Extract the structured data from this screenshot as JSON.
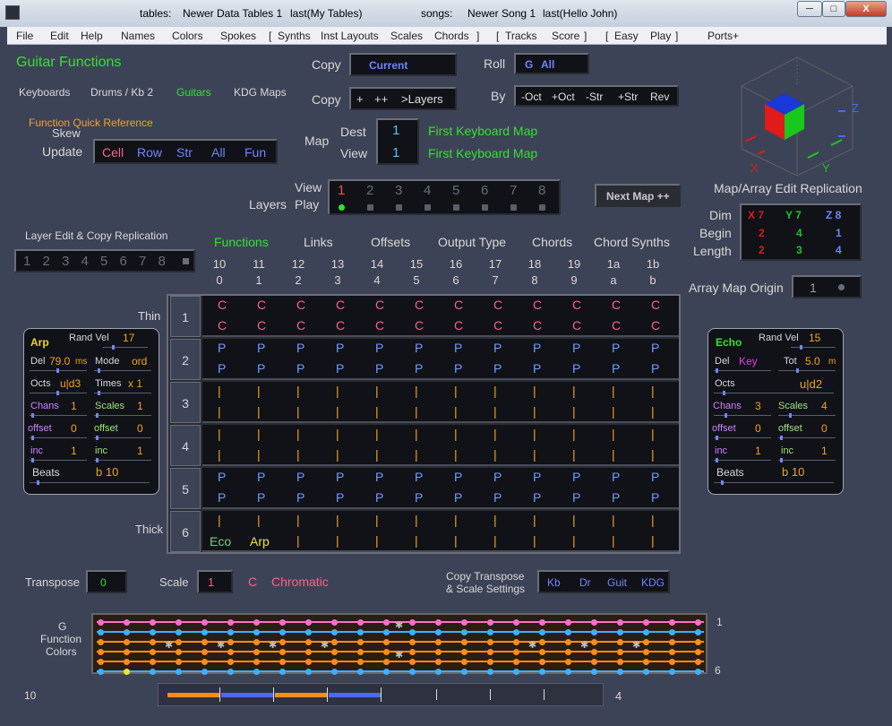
{
  "titlebar": {
    "tables_label": "tables:",
    "tables_value": "Newer Data Tables 1",
    "tables_last": "last(My Tables)",
    "songs_label": "songs:",
    "songs_value": "Newer Song 1",
    "songs_last": "last(Hello John)",
    "min": "─",
    "max": "□",
    "close": "X"
  },
  "menu": [
    "File",
    "Edit",
    "Help",
    "Names",
    "Colors",
    "Spokes",
    "[",
    "Synths",
    "Inst Layouts",
    "Scales",
    "Chords",
    "]",
    "[",
    "Tracks",
    "Score",
    "]",
    "[",
    "Easy",
    "Play",
    "]",
    "Ports+"
  ],
  "header": {
    "title": "Guitar  Functions",
    "tabs": [
      "Keyboards",
      "Drums / Kb 2",
      "Guitars",
      "KDG Maps"
    ],
    "quick_ref": "Function Quick Reference",
    "skew": "Skew",
    "update_label": "Update",
    "update_opts": [
      "Cell",
      "Row",
      "Str",
      "All",
      "Fun"
    ]
  },
  "copy": {
    "label1": "Copy",
    "value1": "Current",
    "label2": "Copy",
    "opts2": [
      "+",
      "++",
      ">Layers"
    ]
  },
  "roll": {
    "label": "Roll",
    "key": "G",
    "value": "All"
  },
  "by": {
    "label": "By",
    "opts": [
      "-Oct",
      "+Oct",
      "-Str",
      "+Str",
      "Rev"
    ]
  },
  "map": {
    "label": "Map",
    "dest_label": "Dest",
    "dest_value": "1",
    "dest_name": "First Keyboard Map",
    "view_label": "View",
    "view_value": "1",
    "view_name": "First Keyboard Map"
  },
  "layers": {
    "view_label": "View",
    "play_label": "Play",
    "layers_label": "Layers",
    "nums": [
      "1",
      "2",
      "3",
      "4",
      "5",
      "6",
      "7",
      "8"
    ]
  },
  "next_map": "Next Map ++",
  "cube": {
    "z": "Z",
    "x": "X",
    "y": "Y"
  },
  "replication": {
    "title": "Map/Array Edit Replication",
    "rows": [
      "Dim",
      "Begin",
      "Length"
    ],
    "dim": [
      "X 7",
      "Y 7",
      "Z 8"
    ],
    "begin": [
      "2",
      "4",
      "1"
    ],
    "length": [
      "2",
      "3",
      "4"
    ],
    "origin_label": "Array Map Origin",
    "origin_value": "1"
  },
  "layer_edit": {
    "title": "Layer Edit & Copy Replication",
    "nums": [
      "1",
      "2",
      "3",
      "4",
      "5",
      "6",
      "7",
      "8"
    ]
  },
  "columns": {
    "tabs": [
      "Functions",
      "Links",
      "Offsets",
      "Output Type",
      "Chords",
      "Chord Synths"
    ],
    "top": [
      "10",
      "11",
      "12",
      "13",
      "14",
      "15",
      "16",
      "17",
      "18",
      "19",
      "1a",
      "1b"
    ],
    "bottom": [
      "0",
      "1",
      "2",
      "3",
      "4",
      "5",
      "6",
      "7",
      "8",
      "9",
      "a",
      "b"
    ]
  },
  "grid": {
    "thin": "Thin",
    "thick": "Thick",
    "rows": [
      {
        "num": "1",
        "glyph": "C",
        "color": "pink"
      },
      {
        "num": "2",
        "glyph": "P",
        "color": "blue"
      },
      {
        "num": "3",
        "glyph": "|",
        "color": "orange"
      },
      {
        "num": "4",
        "glyph": "|",
        "color": "orange"
      },
      {
        "num": "5",
        "glyph": "P",
        "color": "blue"
      },
      {
        "num": "6",
        "glyph": "|",
        "color": "orange"
      }
    ],
    "row6_eco": "Eco",
    "row6_arp": "Arp"
  },
  "arp": {
    "title": "Arp",
    "rand_vel_label": "Rand Vel",
    "rand_vel": "17",
    "del_label": "Del",
    "del_value": "79.0",
    "del_unit": "ms",
    "mode_label": "Mode",
    "mode_value": "ord",
    "octs_label": "Octs",
    "octs_value": "u|d3",
    "times_label": "Times",
    "times_value": "x 1",
    "chans_label": "Chans",
    "chans_value": "1",
    "scales_label": "Scales",
    "scales_value": "1",
    "offset_label": "offset",
    "offset1": "0",
    "offset2": "0",
    "inc_label": "inc",
    "inc1": "1",
    "inc2": "1",
    "beats_label": "Beats",
    "beats_value": "b 10"
  },
  "echo": {
    "title": "Echo",
    "rand_vel_label": "Rand Vel",
    "rand_vel": "15",
    "del_label": "Del",
    "del_value": "Key",
    "tot_label": "Tot",
    "tot_value": "5.0",
    "tot_unit": "m",
    "octs_label": "Octs",
    "octs_value": "u|d2",
    "chans_label": "Chans",
    "chans_value": "3",
    "scales_label": "Scales",
    "scales_value": "4",
    "offset_label": "offset",
    "offset1": "0",
    "offset2": "0",
    "inc_label": "inc",
    "inc1": "1",
    "inc2": "1",
    "beats_label": "Beats",
    "beats_value": "b 10"
  },
  "transpose": {
    "label": "Transpose",
    "value": "0"
  },
  "scale": {
    "label": "Scale",
    "value": "1",
    "key": "C",
    "name": "Chromatic"
  },
  "copy_transpose": {
    "line1": "Copy Transpose",
    "line2": "& Scale Settings",
    "opts": [
      "Kb",
      "Dr",
      "Guit",
      "KDG"
    ]
  },
  "fretboard": {
    "label1": "G",
    "label2": "Function",
    "label3": "Colors",
    "top_string": "1",
    "bottom_string": "6",
    "string_colors": [
      "#ff6ec7",
      "#3fb0ff",
      "#ff8c1a",
      "#ff8c1a",
      "#ff8c1a",
      "#3fb0ff"
    ]
  },
  "bottom": {
    "left_num": "10",
    "right_num": "4"
  },
  "colors": {
    "bg": "#3d4356",
    "accent_green": "#33e033",
    "accent_orange": "#f2a41c",
    "accent_pink": "#ff5f88",
    "accent_blue": "#6f86ff"
  }
}
